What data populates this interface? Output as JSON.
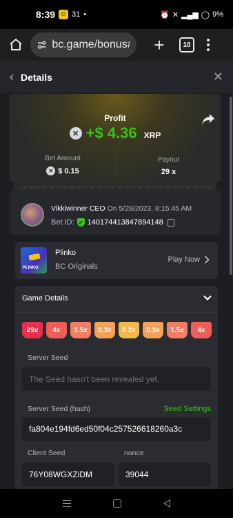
{
  "status_bar": {
    "time": "8:39",
    "notif_count": "31",
    "battery": "9%"
  },
  "browser": {
    "url": "bc.game/bonus#",
    "tab_count": "10"
  },
  "header": {
    "title": "Details"
  },
  "profit": {
    "label": "Profit",
    "value": "+$ 4.36",
    "currency": "XRP"
  },
  "bet": {
    "amount_label": "Bet Amount",
    "amount_value": "$ 0.15",
    "payout_label": "Payout",
    "payout_value": "29 x"
  },
  "user": {
    "name": "Vikkiwinner CEO",
    "timestamp": "On 5/28/2023, 8:15:45 AM",
    "bet_id_label": "Bet ID:",
    "bet_id": "140174413847894148"
  },
  "game": {
    "name": "Plinko",
    "provider": "BC Originals",
    "play_label": "Play Now",
    "thumb_text": "PLINKO"
  },
  "game_details": {
    "title": "Game Details",
    "multipliers": [
      "29x",
      "4x",
      "1.5x",
      "0.3x",
      "0.2x",
      "0.3x",
      "1.5x",
      "4x"
    ],
    "server_seed_label": "Server Seed",
    "server_seed_placeholder": "The Seed hasn't been revealed yet.",
    "server_seed_hash_label": "Server Seed (hash)",
    "seed_settings_label": "Seed Settings",
    "server_seed_hash": "fa804e194fd6ed50f04c257526618260a3c",
    "client_seed_label": "Client Seed",
    "client_seed": "76Y08WGXZiDM",
    "nonce_label": "nonce",
    "nonce": "39044"
  },
  "colors": {
    "profit_green": "#3bc117",
    "panel_bg": "#1c1e22"
  }
}
